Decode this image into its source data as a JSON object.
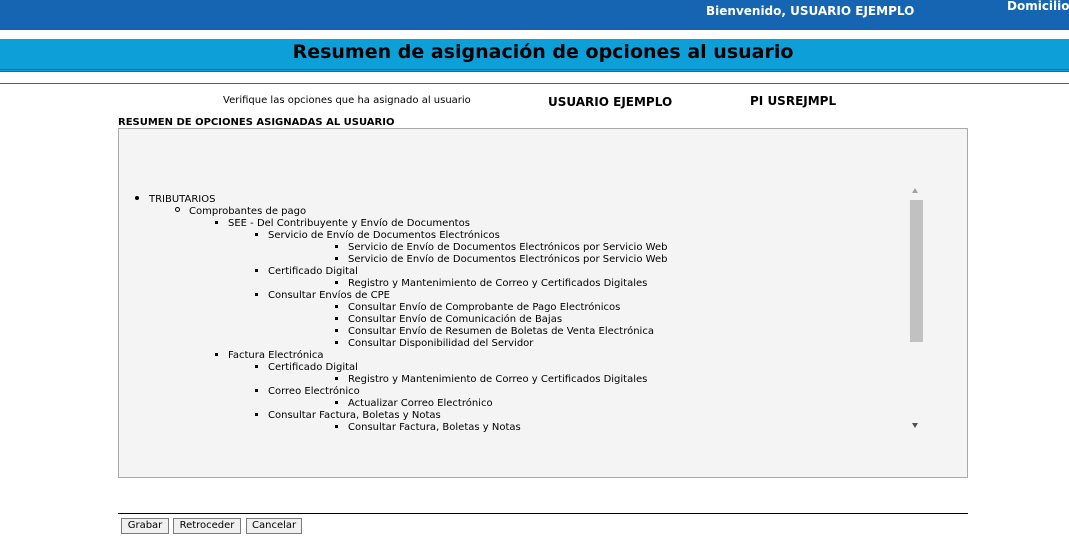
{
  "header": {
    "welcome": "Bienvenido, USUARIO EJEMPLO",
    "domicilio": "Domicilio:"
  },
  "page_title": "Resumen de asignación de opciones al usuario",
  "info": {
    "verify_text": "Verifique las opciones que ha asignado al usuario",
    "user_name": "USUARIO EJEMPLO",
    "user_code": "PI USREJMPL"
  },
  "section_title": "RESUMEN DE OPCIONES ASIGNADAS AL USUARIO",
  "tree": [
    {
      "level": 1,
      "label": "TRIBUTARIOS"
    },
    {
      "level": 2,
      "label": "Comprobantes de pago"
    },
    {
      "level": 3,
      "label": "SEE - Del Contribuyente y Envío de Documentos"
    },
    {
      "level": 4,
      "label": "Servicio de Envío de Documentos Electrónicos"
    },
    {
      "level": 6,
      "label": "Servicio de Envío de Documentos Electrónicos por Servicio Web"
    },
    {
      "level": 6,
      "label": "Servicio de Envío de Documentos Electrónicos por Servicio Web"
    },
    {
      "level": 4,
      "label": "Certificado Digital"
    },
    {
      "level": 6,
      "label": "Registro y Mantenimiento de Correo y Certificados Digitales"
    },
    {
      "level": 4,
      "label": "Consultar Envíos de CPE"
    },
    {
      "level": 6,
      "label": "Consultar Envío de Comprobante de Pago Electrónicos"
    },
    {
      "level": 6,
      "label": "Consultar Envío de Comunicación de Bajas"
    },
    {
      "level": 6,
      "label": "Consultar Envío de Resumen de Boletas de Venta Electrónica"
    },
    {
      "level": 6,
      "label": "Consultar Disponibilidad del Servidor"
    },
    {
      "level": 3,
      "label": "Factura Electrónica"
    },
    {
      "level": 4,
      "label": "Certificado Digital"
    },
    {
      "level": 6,
      "label": "Registro y Mantenimiento de Correo y Certificados Digitales"
    },
    {
      "level": 4,
      "label": "Correo Electrónico"
    },
    {
      "level": 6,
      "label": "Actualizar Correo Electrónico"
    },
    {
      "level": 4,
      "label": "Consultar Factura, Boletas y Notas"
    },
    {
      "level": 6,
      "label": "Consultar Factura, Boletas y Notas"
    }
  ],
  "buttons": {
    "save": "Grabar",
    "back": "Retroceder",
    "cancel": "Cancelar"
  }
}
